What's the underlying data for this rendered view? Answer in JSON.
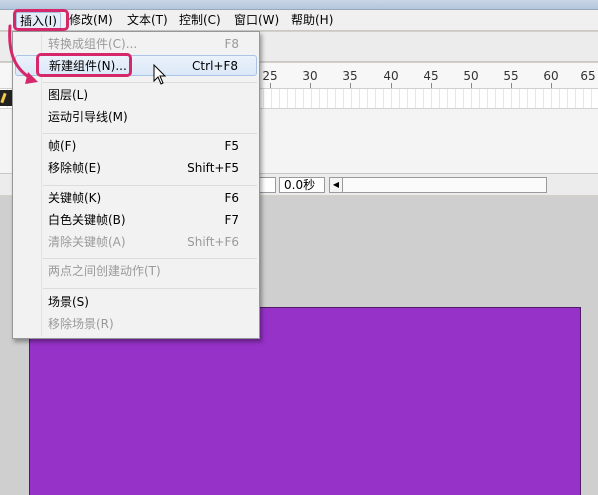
{
  "menubar": {
    "items": [
      {
        "label": "插入(I)"
      },
      {
        "label": "修改(M)"
      },
      {
        "label": "文本(T)"
      },
      {
        "label": "控制(C)"
      },
      {
        "label": "窗口(W)"
      },
      {
        "label": "帮助(H)"
      }
    ]
  },
  "insert_menu": {
    "items": [
      {
        "label": "转换成组件(C)...",
        "shortcut": "F8"
      },
      {
        "label": "新建组件(N)...",
        "shortcut": "Ctrl+F8"
      },
      {
        "label": "图层(L)",
        "shortcut": ""
      },
      {
        "label": "运动引导线(M)",
        "shortcut": ""
      },
      {
        "label": "帧(F)",
        "shortcut": "F5"
      },
      {
        "label": "移除帧(E)",
        "shortcut": "Shift+F5"
      },
      {
        "label": "关键帧(K)",
        "shortcut": "F6"
      },
      {
        "label": "白色关键帧(B)",
        "shortcut": "F7"
      },
      {
        "label": "清除关键帧(A)",
        "shortcut": "Shift+F6"
      },
      {
        "label": "两点之间创建动作(T)",
        "shortcut": ""
      },
      {
        "label": "场景(S)",
        "shortcut": ""
      },
      {
        "label": "移除场景(R)",
        "shortcut": ""
      }
    ]
  },
  "timeline": {
    "ruler_ticks": [
      "25",
      "30",
      "35",
      "40",
      "45",
      "50",
      "55",
      "60",
      "65"
    ],
    "elapsed_time": "0.0秒"
  },
  "colors": {
    "stage": "#9632c8",
    "highlight": "#d4286a"
  }
}
